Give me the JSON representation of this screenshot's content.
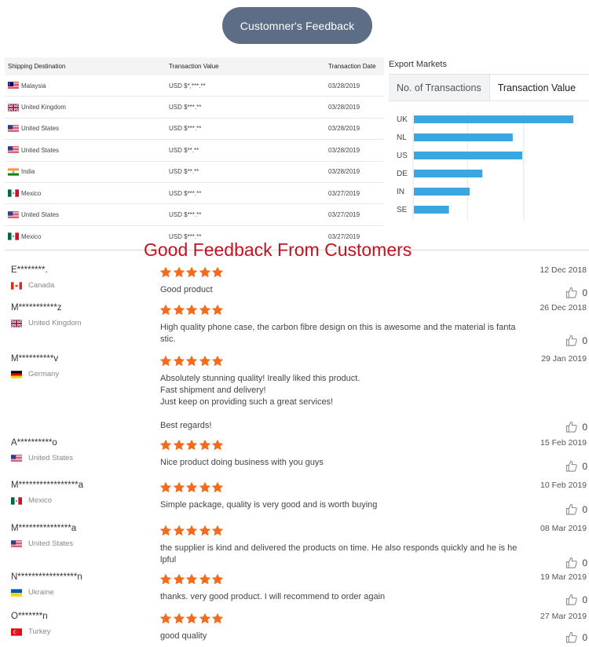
{
  "header": {
    "title": "Customner's Feedback"
  },
  "transactions": {
    "columns": [
      "Shipping Destination",
      "Transaction Value",
      "Transaction Date"
    ],
    "rows": [
      {
        "flag": "my-flag-icon",
        "country": "Malaysia",
        "value": "USD $*,***.**",
        "date": "03/28/2019"
      },
      {
        "flag": "uk-flag-icon",
        "country": "United Kingdom",
        "value": "USD $***.**",
        "date": "03/28/2019"
      },
      {
        "flag": "us-flag-icon",
        "country": "United States",
        "value": "USD $***.**",
        "date": "03/28/2019"
      },
      {
        "flag": "us-flag-icon",
        "country": "United States",
        "value": "USD $**.**",
        "date": "03/28/2019"
      },
      {
        "flag": "in-flag-icon",
        "country": "India",
        "value": "USD $**.**",
        "date": "03/28/2019"
      },
      {
        "flag": "mx-flag-icon",
        "country": "Mexico",
        "value": "USD $***.**",
        "date": "03/27/2019"
      },
      {
        "flag": "us-flag-icon",
        "country": "United States",
        "value": "USD $***.**",
        "date": "03/27/2019"
      },
      {
        "flag": "mx-flag-icon",
        "country": "Mexico",
        "value": "USD $***.**",
        "date": "03/27/2019"
      }
    ]
  },
  "export_markets": {
    "title": "Export Markets",
    "tabs": [
      "No. of Transactions",
      "Transaction Value"
    ],
    "selected_tab": "Transaction Value"
  },
  "chart_data": {
    "type": "bar",
    "orientation": "horizontal",
    "categories": [
      "UK",
      "NL",
      "US",
      "DE",
      "IN",
      "SE"
    ],
    "values": [
      100,
      62,
      68,
      43,
      35,
      22
    ],
    "grid": true,
    "bar_color": "#3aa7e0"
  },
  "feedback": {
    "heading": "Good Feedback From Customers",
    "star_color": "#f36b1c",
    "reviews": [
      {
        "name": "E********.",
        "country": "Canada",
        "flag": "ca-flag-icon",
        "stars": 5,
        "date": "12 Dec 2018",
        "lines": [
          "Good product"
        ],
        "likes": "0"
      },
      {
        "name": "M***********z",
        "country": "United Kingdom",
        "flag": "uk-flag-icon",
        "stars": 5,
        "date": "26 Dec 2018",
        "lines": [
          "High quality phone case, the carbon fibre design on this is awesome and the material is fanta",
          "stic."
        ],
        "likes": "0"
      },
      {
        "name": "M**********v",
        "country": "Germany",
        "flag": "de-flag-icon",
        "stars": 5,
        "date": "29 Jan 2019",
        "lines": [
          "Absolutely stunning quality! Ireally liked this product.",
          "Fast shipment and delivery!",
          "Just keep on providing such a great services!",
          "",
          "Best regards!"
        ],
        "likes": "0"
      },
      {
        "name": "A**********o",
        "country": "United States",
        "flag": "us-flag-icon",
        "stars": 5,
        "date": "15 Feb 2019",
        "lines": [
          "Nice product doing business with you guys"
        ],
        "likes": "0"
      },
      {
        "name": "M*****************a",
        "country": "Mexico",
        "flag": "mx-flag-icon",
        "stars": 5,
        "date": "10 Feb 2019",
        "lines": [
          "Simple package, quality is very good and is worth buying"
        ],
        "likes": "0"
      },
      {
        "name": "M***************a",
        "country": "United States",
        "flag": "us-flag-icon",
        "stars": 5,
        "date": "08 Mar 2019",
        "lines": [
          "the supplier is kind and delivered the products on time. He also responds quickly and he is he",
          "lpful"
        ],
        "likes": "0"
      },
      {
        "name": "N*****************n",
        "country": "Ukraine",
        "flag": "ua-flag-icon",
        "stars": 5,
        "date": "19 Mar 2019",
        "lines": [
          "thanks. very good product. I will recommend to order again"
        ],
        "likes": "0"
      },
      {
        "name": "O*******n",
        "country": "Turkey",
        "flag": "tr-flag-icon",
        "stars": 5,
        "date": "27 Mar 2019",
        "lines": [
          "good quality"
        ],
        "likes": "0"
      }
    ]
  }
}
